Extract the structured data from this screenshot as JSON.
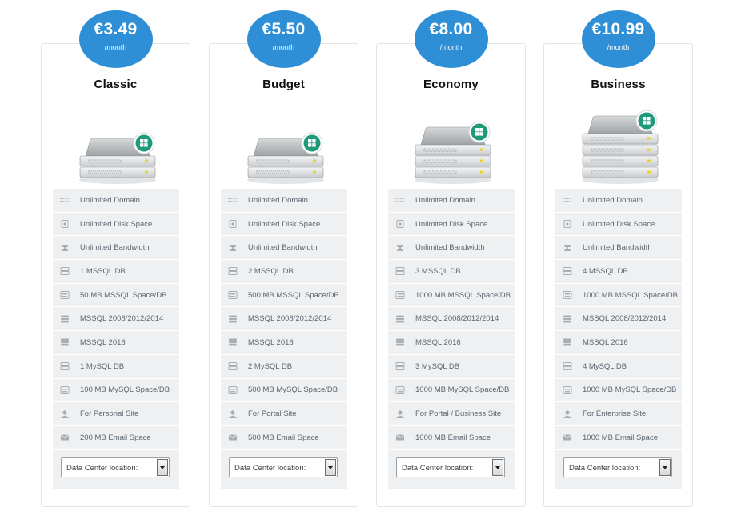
{
  "feature_icons": [
    "grid-icon",
    "disk-icon",
    "bandwidth-icon",
    "database-icon",
    "database-space-icon",
    "database-version-icon",
    "database-version-icon",
    "database-icon",
    "database-space-icon",
    "user-icon",
    "mail-icon"
  ],
  "colors": {
    "price_badge": "#2e8fd6",
    "feature_bg": "#eef0f1",
    "windows_badge": "#1f9a7a"
  },
  "plans": [
    {
      "price": "€3.49",
      "period": "/month",
      "name": "Classic",
      "features": [
        "Unlimited Domain",
        "Unlimited Disk Space",
        "Unlimited Bandwidth",
        "1 MSSQL DB",
        "50 MB MSSQL Space/DB",
        "MSSQL 2008/2012/2014",
        "MSSQL 2016",
        "1 MySQL DB",
        "100 MB MySQL Space/DB",
        "For Personal Site",
        "200 MB Email Space"
      ],
      "dc_label": "Data Center location:"
    },
    {
      "price": "€5.50",
      "period": "/month",
      "name": "Budget",
      "features": [
        "Unlimited Domain",
        "Unlimited Disk Space",
        "Unlimited Bandwidth",
        "2 MSSQL DB",
        "500 MB MSSQL Space/DB",
        "MSSQL 2008/2012/2014",
        "MSSQL 2016",
        "2 MySQL DB",
        "500 MB MySQL Space/DB",
        "For Portal Site",
        "500 MB Email Space"
      ],
      "dc_label": "Data Center location:"
    },
    {
      "price": "€8.00",
      "period": "/month",
      "name": "Economy",
      "features": [
        "Unlimited Domain",
        "Unlimited Disk Space",
        "Unlimited Bandwidth",
        "3 MSSQL DB",
        "1000 MB MSSQL Space/DB",
        "MSSQL 2008/2012/2014",
        "MSSQL 2016",
        "3 MySQL DB",
        "1000 MB MySQL Space/DB",
        "For Portal / Business Site",
        "1000 MB Email Space"
      ],
      "dc_label": "Data Center location:"
    },
    {
      "price": "€10.99",
      "period": "/month",
      "name": "Business",
      "features": [
        "Unlimited Domain",
        "Unlimited Disk Space",
        "Unlimited Bandwidth",
        "4 MSSQL DB",
        "1000 MB MSSQL Space/DB",
        "MSSQL 2008/2012/2014",
        "MSSQL 2016",
        "4 MySQL DB",
        "1000 MB MySQL Space/DB",
        "For Enterprise Site",
        "1000 MB Email Space"
      ],
      "dc_label": "Data Center location:"
    }
  ]
}
